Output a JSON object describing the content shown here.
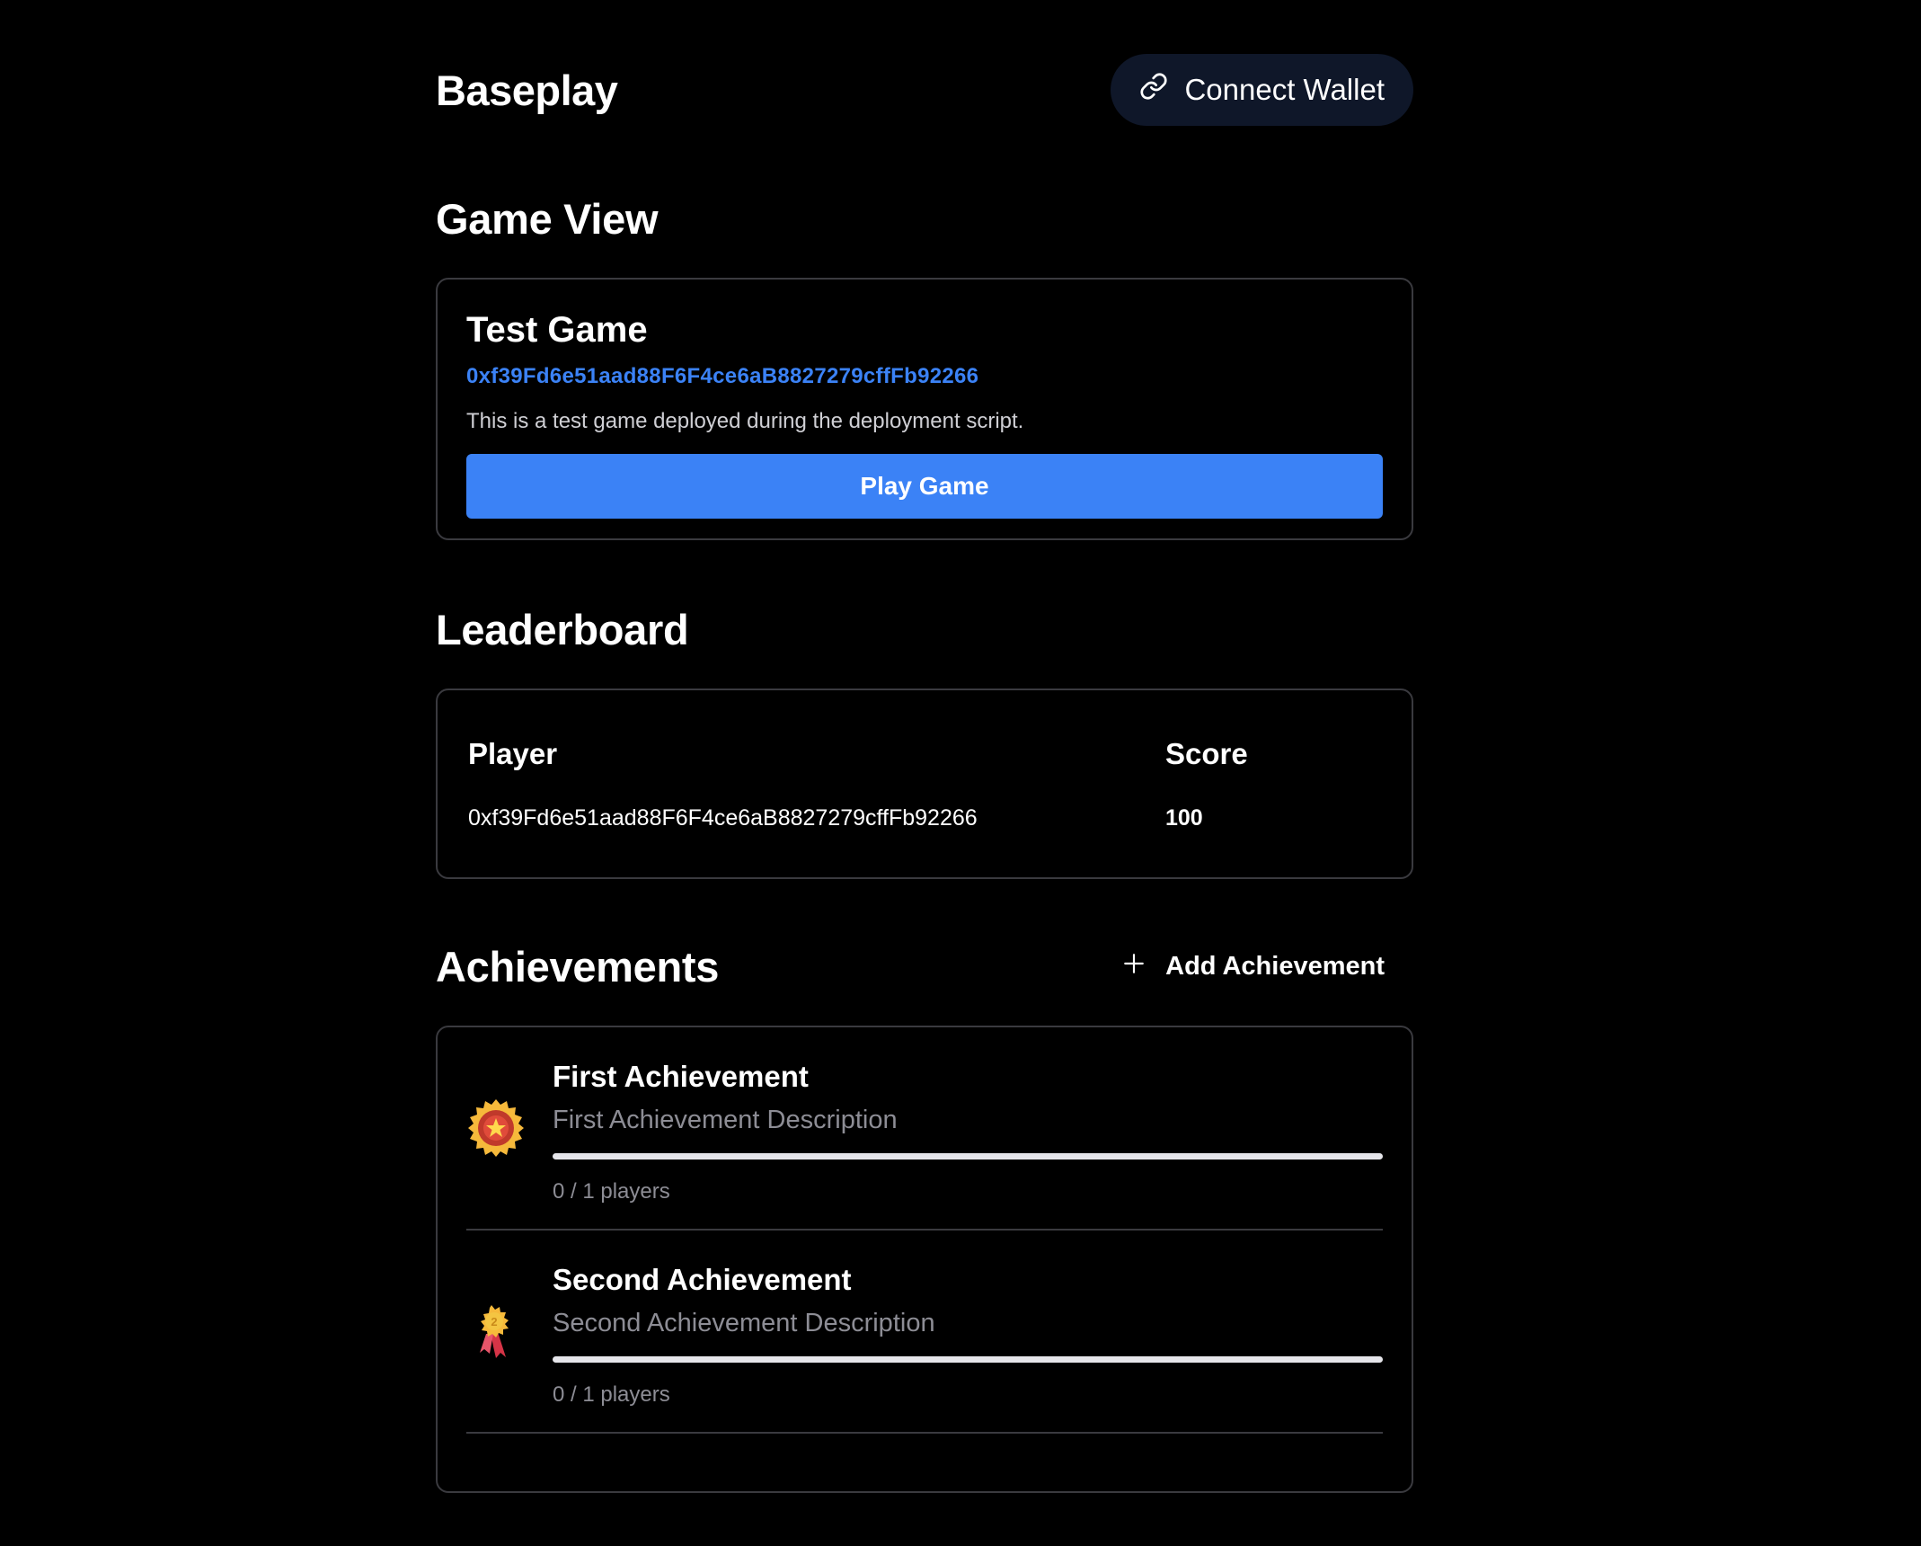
{
  "header": {
    "brand": "Baseplay",
    "wallet_button": "Connect Wallet"
  },
  "game_view": {
    "section_title": "Game View",
    "name": "Test Game",
    "address": "0xf39Fd6e51aad88F6F4ce6aB8827279cffFb92266",
    "description": "This is a test game deployed during the deployment script.",
    "play_button": "Play Game"
  },
  "leaderboard": {
    "section_title": "Leaderboard",
    "columns": [
      "Player",
      "Score"
    ],
    "rows": [
      {
        "player": "0xf39Fd6e51aad88F6F4ce6aB8827279cffFb92266",
        "score": "100"
      }
    ]
  },
  "achievements": {
    "section_title": "Achievements",
    "add_button": "Add Achievement",
    "items": [
      {
        "name": "First Achievement",
        "description": "First Achievement Description",
        "count_text": "0 / 1 players",
        "progress": 0,
        "icon": "gold-star-medal-icon"
      },
      {
        "name": "Second Achievement",
        "description": "Second Achievement Description",
        "count_text": "0 / 1 players",
        "progress": 0,
        "icon": "ribbon-medal-icon"
      }
    ]
  },
  "colors": {
    "accent": "#3b82f6",
    "wallet_bg": "#0f1729",
    "border": "#3a3a3f",
    "muted_text": "#8d8d95"
  }
}
